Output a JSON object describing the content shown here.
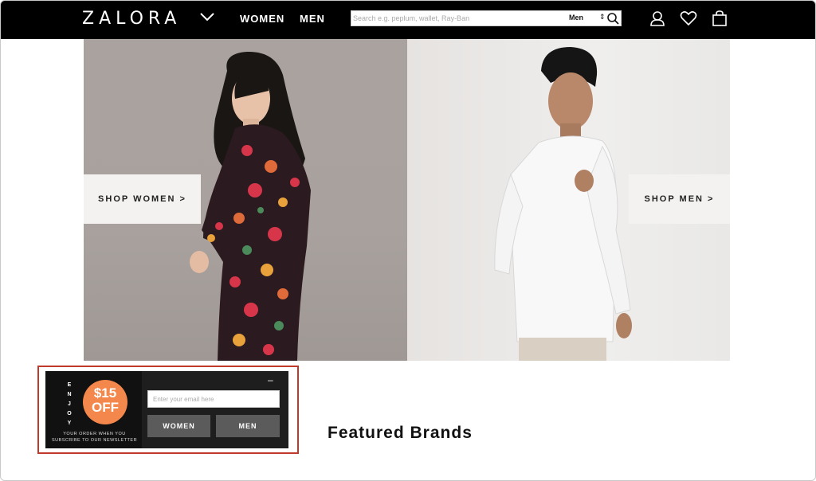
{
  "header": {
    "logo": "ZALORA",
    "nav": [
      "WOMEN",
      "MEN"
    ],
    "search": {
      "placeholder": "Search e.g. peplum, wallet, Ray-Ban",
      "value": "",
      "category": "Men"
    }
  },
  "hero": {
    "women_cta": "SHOP WOMEN >",
    "men_cta": "SHOP MEN >"
  },
  "newsletter": {
    "vertical_text": "ENJOY",
    "amount": "$15",
    "off": "OFF",
    "subtext": "YOUR ORDER WHEN YOU SUBSCRIBE TO OUR NEWSLETTER",
    "close": "–",
    "email_placeholder": "Enter your email here",
    "buttons": [
      "WOMEN",
      "MEN"
    ]
  },
  "featured": {
    "title": "Featured Brands"
  },
  "colors": {
    "header_bg": "#000000",
    "badge": "#f4874b",
    "highlight_outline": "#c0392b",
    "newsletter_bg": "#1e1e1e",
    "button_bg": "#5b5b5b"
  }
}
